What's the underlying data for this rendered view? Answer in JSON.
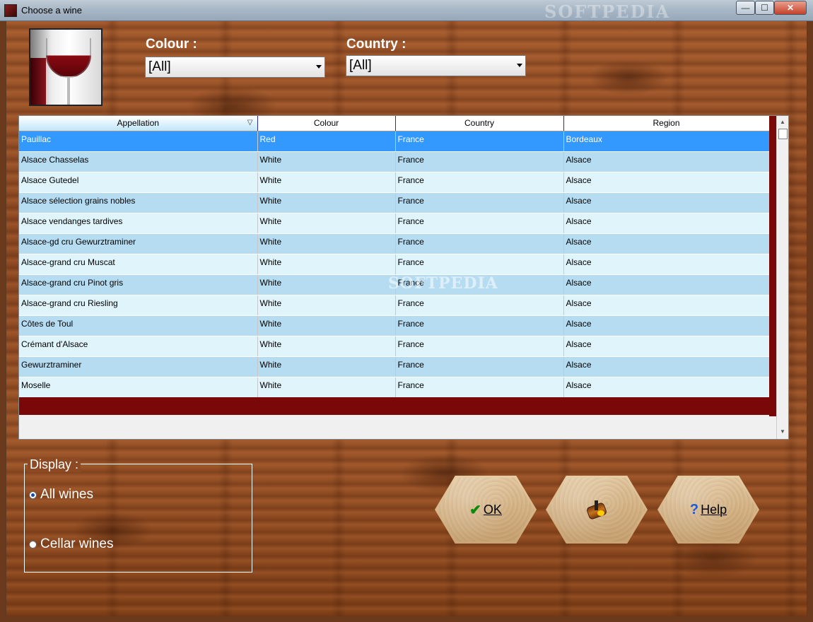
{
  "window": {
    "title": "Choose a wine",
    "watermark": "SOFTPEDIA",
    "controls": {
      "minimize": "—",
      "maximize": "☐",
      "close": "✕"
    }
  },
  "filters": {
    "colour": {
      "label": "Colour :",
      "value": "[All]"
    },
    "country": {
      "label": "Country :",
      "value": "[All]"
    }
  },
  "grid": {
    "columns": [
      "Appellation",
      "Colour",
      "Country",
      "Region"
    ],
    "sorted_column": "Appellation",
    "sort_indicator": "▽",
    "rows": [
      {
        "appellation": "Pauillac",
        "colour": "Red",
        "country": "France",
        "region": "Bordeaux"
      },
      {
        "appellation": "Alsace Chasselas",
        "colour": "White",
        "country": "France",
        "region": "Alsace"
      },
      {
        "appellation": "Alsace Gutedel",
        "colour": "White",
        "country": "France",
        "region": "Alsace"
      },
      {
        "appellation": "Alsace sélection grains nobles",
        "colour": "White",
        "country": "France",
        "region": "Alsace"
      },
      {
        "appellation": "Alsace vendanges tardives",
        "colour": "White",
        "country": "France",
        "region": "Alsace"
      },
      {
        "appellation": "Alsace-gd cru Gewurztraminer",
        "colour": "White",
        "country": "France",
        "region": "Alsace"
      },
      {
        "appellation": "Alsace-grand cru Muscat",
        "colour": "White",
        "country": "France",
        "region": "Alsace"
      },
      {
        "appellation": "Alsace-grand cru Pinot gris",
        "colour": "White",
        "country": "France",
        "region": "Alsace"
      },
      {
        "appellation": "Alsace-grand cru Riesling",
        "colour": "White",
        "country": "France",
        "region": "Alsace"
      },
      {
        "appellation": "Côtes de Toul",
        "colour": "White",
        "country": "France",
        "region": "Alsace"
      },
      {
        "appellation": "Crémant d'Alsace",
        "colour": "White",
        "country": "France",
        "region": "Alsace"
      },
      {
        "appellation": "Gewurztraminer",
        "colour": "White",
        "country": "France",
        "region": "Alsace"
      },
      {
        "appellation": "Moselle",
        "colour": "White",
        "country": "France",
        "region": "Alsace"
      }
    ],
    "watermark": "SOFTPEDIA"
  },
  "display": {
    "label": "Display :",
    "options": [
      {
        "label": "All wines",
        "checked": true
      },
      {
        "label": "Cellar wines",
        "checked": false
      }
    ]
  },
  "buttons": {
    "ok": {
      "label": "OK",
      "icon": "check-icon"
    },
    "cellar": {
      "icon": "cellar-icon"
    },
    "help": {
      "label": "Help",
      "icon": "help-icon"
    }
  },
  "colors": {
    "selected_row": "#3399ff",
    "row_odd": "#dff4fb",
    "row_even": "#b6dcf2",
    "footer_band": "#7a0808"
  }
}
